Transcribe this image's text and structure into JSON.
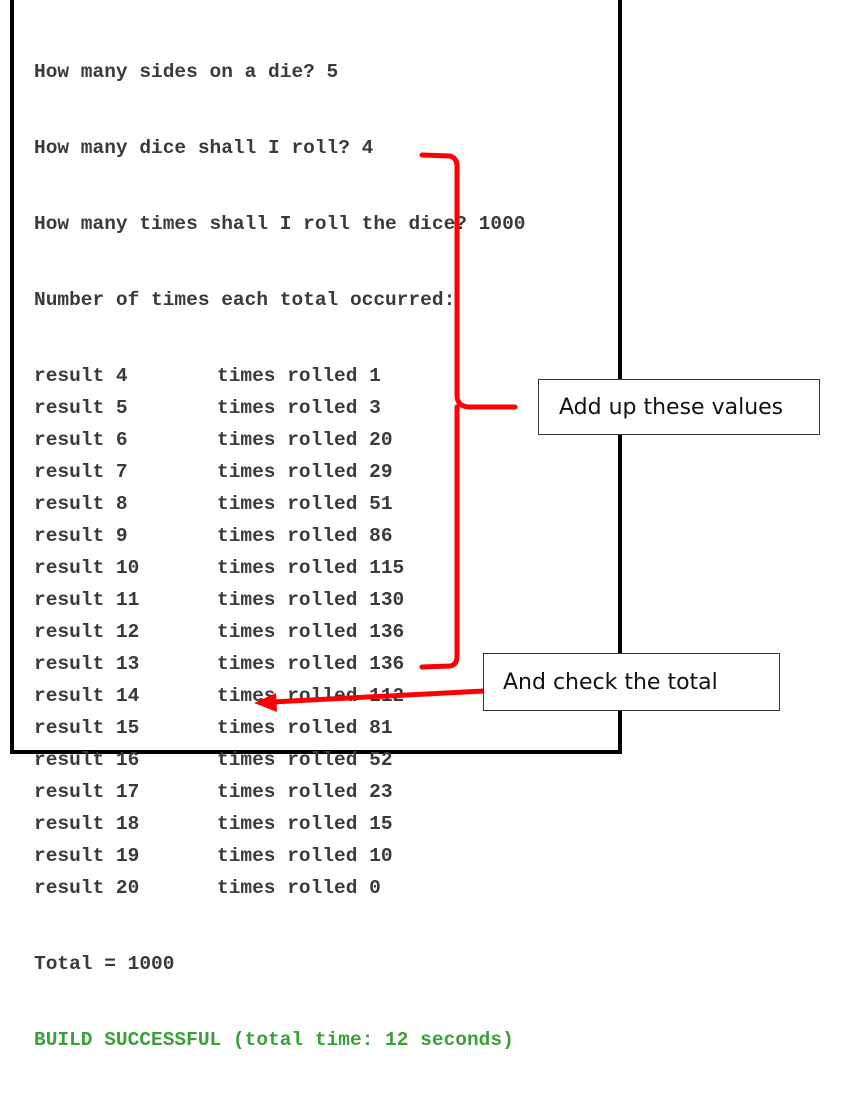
{
  "console": {
    "prompts": [
      "How many sides on a die? 5",
      "How many dice shall I roll? 4",
      "How many times shall I roll the dice? 1000",
      "Number of times each total occurred:"
    ],
    "results": [
      {
        "label": "result 4",
        "value": "times rolled 1"
      },
      {
        "label": "result 5",
        "value": "times rolled 3"
      },
      {
        "label": "result 6",
        "value": "times rolled 20"
      },
      {
        "label": "result 7",
        "value": "times rolled 29"
      },
      {
        "label": "result 8",
        "value": "times rolled 51"
      },
      {
        "label": "result 9",
        "value": "times rolled 86"
      },
      {
        "label": "result 10",
        "value": "times rolled 115"
      },
      {
        "label": "result 11",
        "value": "times rolled 130"
      },
      {
        "label": "result 12",
        "value": "times rolled 136"
      },
      {
        "label": "result 13",
        "value": "times rolled 136"
      },
      {
        "label": "result 14",
        "value": "times rolled 112"
      },
      {
        "label": "result 15",
        "value": "times rolled 81"
      },
      {
        "label": "result 16",
        "value": "times rolled 52"
      },
      {
        "label": "result 17",
        "value": "times rolled 23"
      },
      {
        "label": "result 18",
        "value": "times rolled 15"
      },
      {
        "label": "result 19",
        "value": "times rolled 10"
      },
      {
        "label": "result 20",
        "value": "times rolled 0"
      }
    ],
    "total": "Total = 1000",
    "build_status": "BUILD SUCCESSFUL (total time: 12 seconds)"
  },
  "annotations": {
    "add_up": "Add up these values",
    "check_total": "And check the total",
    "annotation_color": "#ff0000"
  },
  "colors": {
    "console_text": "#3a3a3a",
    "build_success": "#3aa03a"
  }
}
